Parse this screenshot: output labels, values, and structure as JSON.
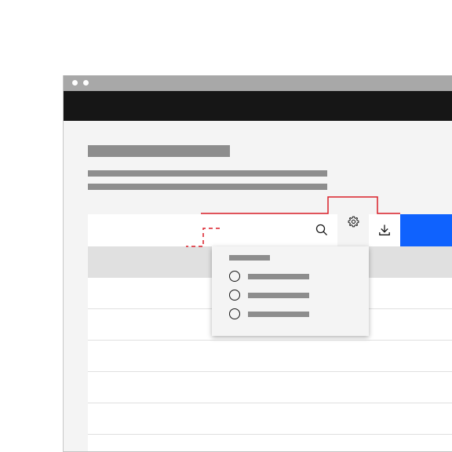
{
  "window": {
    "titlebar_color": "#a8a8a8",
    "header_color": "#161616"
  },
  "toolbar": {
    "search_icon": "search-icon",
    "settings_icon": "gear-icon",
    "download_icon": "download-icon",
    "primary_button_color": "#0f62fe"
  },
  "table": {
    "header_color": "#e0e0e0",
    "row_count": 5
  },
  "dropdown": {
    "option_count": 3,
    "radio_icon": "radio-icon"
  },
  "annotation": {
    "highlight_color": "#da1e28"
  }
}
